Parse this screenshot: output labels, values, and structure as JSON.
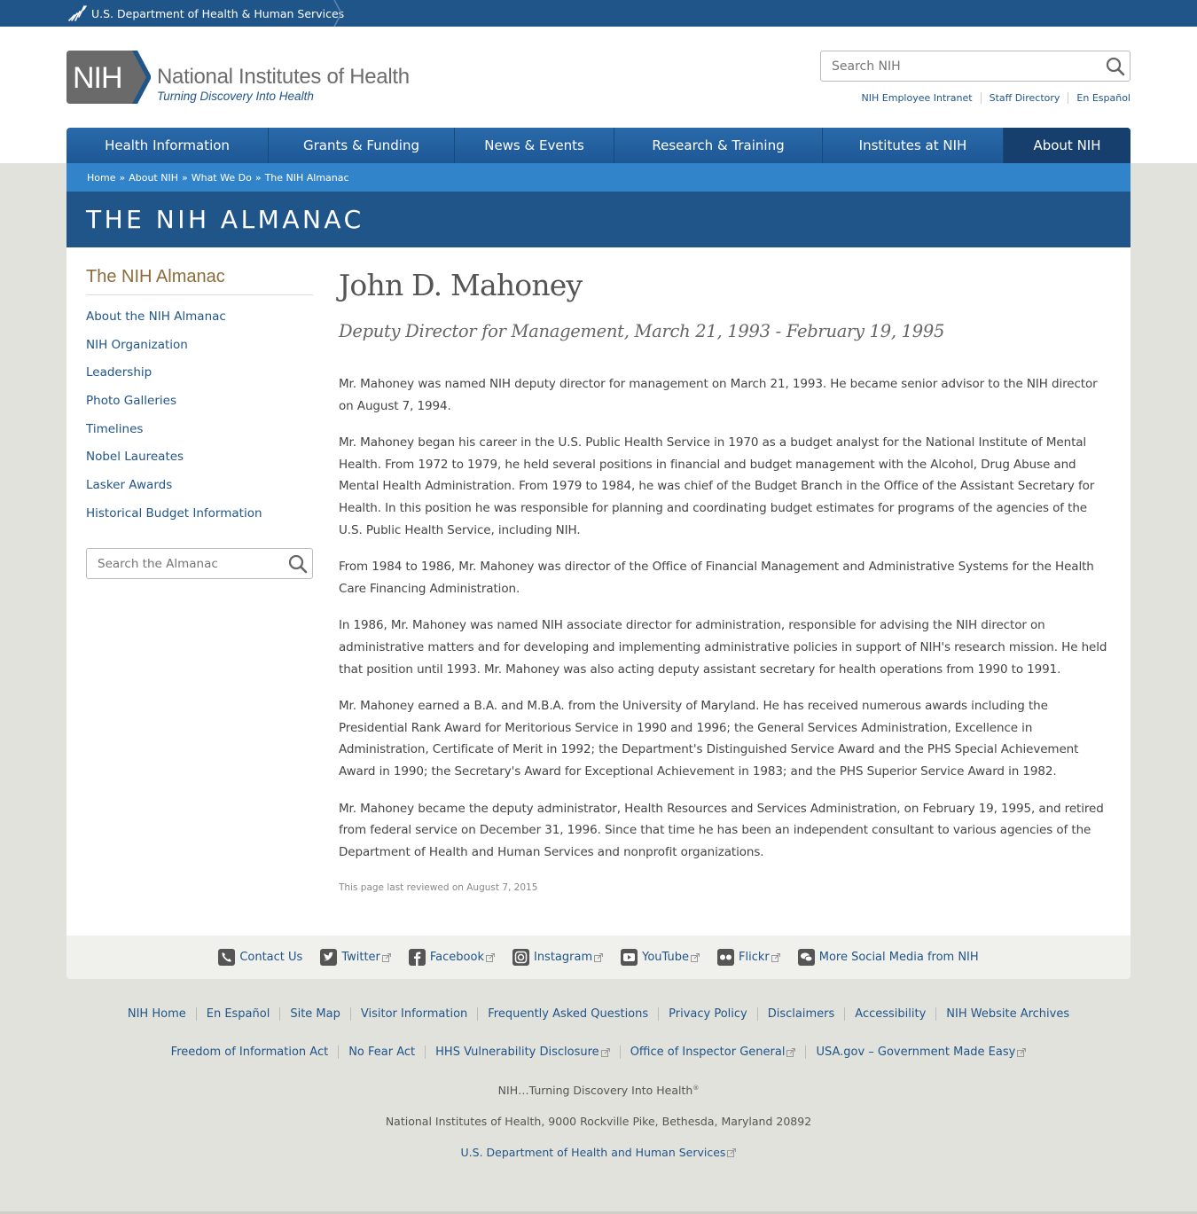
{
  "hhs_bar": {
    "label": "U.S. Department of Health & Human Services"
  },
  "header": {
    "logo_text": "NIH",
    "org_name": "National Institutes of Health",
    "tagline": "Turning Discovery Into Health",
    "search_placeholder": "Search NIH",
    "utility_links": [
      "NIH Employee Intranet",
      "Staff Directory",
      "En Español"
    ]
  },
  "nav": {
    "items": [
      {
        "label": "Health Information"
      },
      {
        "label": "Grants & Funding"
      },
      {
        "label": "News & Events"
      },
      {
        "label": "Research & Training"
      },
      {
        "label": "Institutes at NIH"
      },
      {
        "label": "About NIH",
        "active": true
      }
    ]
  },
  "breadcrumb": [
    "Home",
    "About NIH",
    "What We Do",
    "The NIH Almanac"
  ],
  "banner_title": "THE NIH ALMANAC",
  "sidebar": {
    "title": "The NIH Almanac",
    "items": [
      "About the NIH Almanac",
      "NIH Organization",
      "Leadership",
      "Photo Galleries",
      "Timelines",
      "Nobel Laureates",
      "Lasker Awards",
      "Historical Budget Information"
    ],
    "search_placeholder": "Search the Almanac"
  },
  "article": {
    "name": "John D. Mahoney",
    "subtitle": "Deputy Director for Management, March 21, 1993 - February 19, 1995",
    "paragraphs": [
      "Mr. Mahoney was named NIH deputy director for management on March 21, 1993. He became senior advisor to the NIH director on August 7, 1994.",
      "Mr. Mahoney began his career in the U.S. Public Health Service in 1970 as a budget analyst for the National Institute of Mental Health. From 1972 to 1979, he held several positions in financial and budget management with the Alcohol, Drug Abuse and Mental Health Administration. From 1979 to 1984, he was chief of the Budget Branch in the Office of the Assistant Secretary for Health. In this position he was responsible for planning and coordinating budget estimates for programs of the agencies of the U.S. Public Health Service, including NIH.",
      "From 1984 to 1986, Mr. Mahoney was director of the Office of Financial Management and Administrative Systems for the Health Care Financing Administration.",
      "In 1986, Mr. Mahoney was named NIH associate director for administration, responsible for advising the NIH director on administrative matters and for developing and implementing administrative policies in support of NIH's research mission. He held that position until 1993. Mr. Mahoney was also acting deputy assistant secretary for health operations from 1990 to 1991.",
      "Mr. Mahoney earned a B.A. and M.B.A. from the University of Maryland. He has received numerous awards including the Presidential Rank Award for Meritorious Service in 1990 and 1996; the General Services Administration, Excellence in Administration, Certificate of Merit in 1992; the Department's Distinguished Service Award and the PHS Special Achievement Award in 1990; the Secretary's Award for Exceptional Achievement in 1983; and the PHS Superior Service Award in 1982.",
      "Mr. Mahoney became the deputy administrator, Health Resources and Services Administration, on February 19, 1995, and retired from federal service on December 31, 1996. Since that time he has been an independent consultant to various agencies of the Department of Health and Human Services and nonprofit organizations."
    ],
    "reviewed": "This page last reviewed on August 7, 2015"
  },
  "social": [
    {
      "label": "Contact Us",
      "icon": "phone-icon",
      "external": false
    },
    {
      "label": "Twitter",
      "icon": "twitter-icon",
      "external": true
    },
    {
      "label": "Facebook",
      "icon": "facebook-icon",
      "external": true
    },
    {
      "label": "Instagram",
      "icon": "instagram-icon",
      "external": true
    },
    {
      "label": "YouTube",
      "icon": "youtube-icon",
      "external": true
    },
    {
      "label": "Flickr",
      "icon": "flickr-icon",
      "external": true
    },
    {
      "label": "More Social Media from NIH",
      "icon": "chat-icon",
      "external": false
    }
  ],
  "footer": {
    "row1": [
      {
        "label": "NIH Home"
      },
      {
        "label": "En Español"
      },
      {
        "label": "Site Map"
      },
      {
        "label": "Visitor Information"
      },
      {
        "label": "Frequently Asked Questions"
      },
      {
        "label": "Privacy Policy"
      },
      {
        "label": "Disclaimers"
      },
      {
        "label": "Accessibility"
      },
      {
        "label": "NIH Website Archives"
      }
    ],
    "row2": [
      {
        "label": "Freedom of Information Act",
        "external": false
      },
      {
        "label": "No Fear Act",
        "external": false
      },
      {
        "label": "HHS Vulnerability Disclosure",
        "external": true
      },
      {
        "label": "Office of Inspector General",
        "external": true
      },
      {
        "label": "USA.gov – Government Made Easy",
        "external": true
      }
    ],
    "tagline": "NIH…Turning Discovery Into Health",
    "tagline_mark": "®",
    "address": "National Institutes of Health, 9000 Rockville Pike, Bethesda, Maryland 20892",
    "hhs_link": "U.S. Department of Health and Human Services"
  },
  "colors": {
    "primary_blue": "#20558a",
    "breadcrumb_blue": "#3184c9",
    "nav_active": "#163f6d",
    "sidebar_title": "#8a6d3b",
    "page_bg": "#e2e2dc"
  }
}
